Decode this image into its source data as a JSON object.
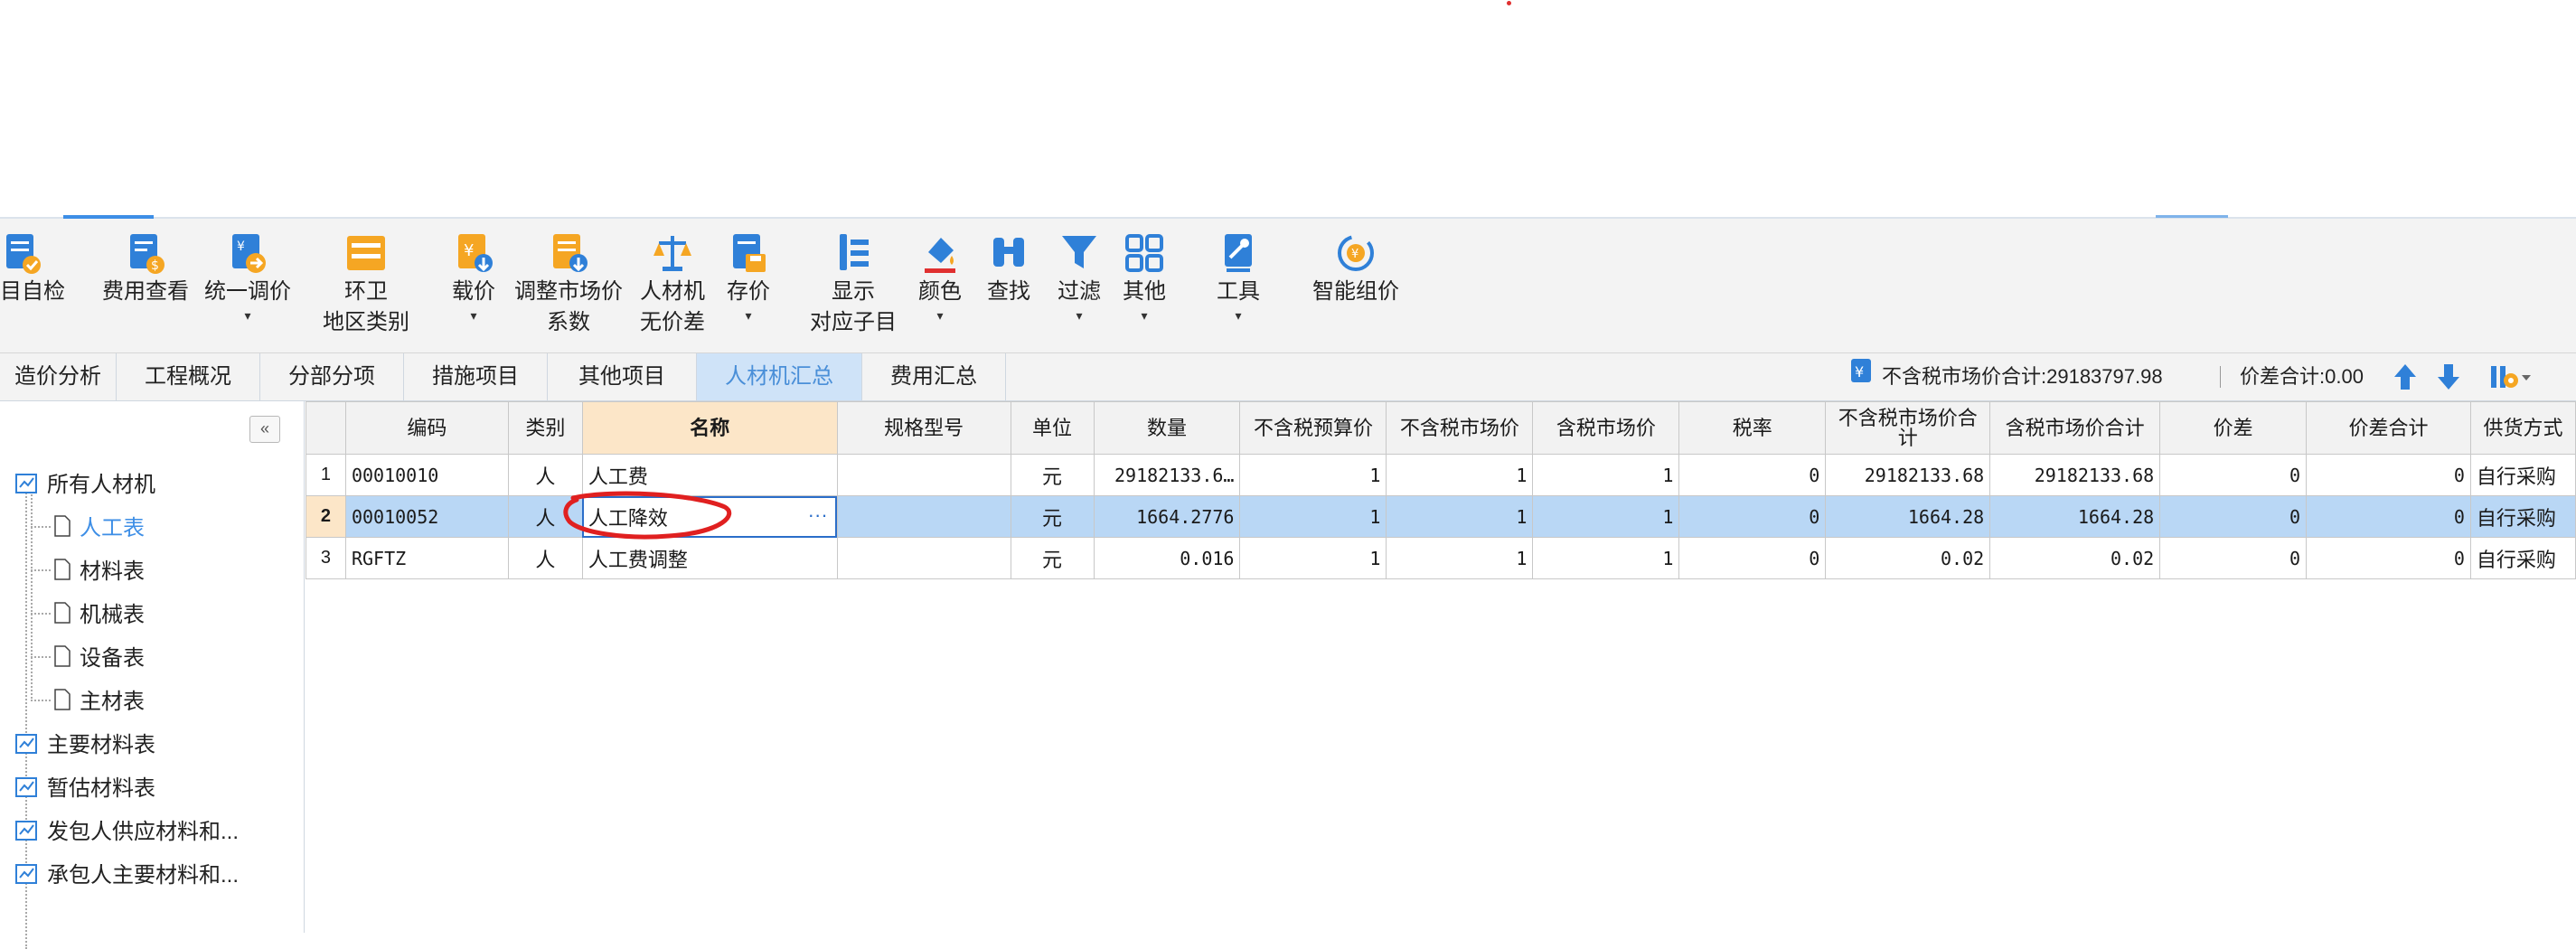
{
  "toolbar": {
    "items": [
      {
        "label": "项目自检",
        "icon": "project-check-icon"
      },
      {
        "label": "费用查看",
        "icon": "cost-view-icon"
      },
      {
        "label": "统一调价",
        "icon": "unified-price-adjust-icon"
      },
      {
        "label": "环卫\n地区类别",
        "icon": "region-category-icon"
      },
      {
        "label": "载价",
        "icon": "load-price-icon"
      },
      {
        "label": "调整市场价\n系数",
        "icon": "market-price-coefficient-icon"
      },
      {
        "label": "人材机\n无价差",
        "icon": "no-price-diff-icon"
      },
      {
        "label": "存价",
        "icon": "save-price-icon"
      },
      {
        "label": "显示\n对应子目",
        "icon": "show-subitem-icon"
      },
      {
        "label": "颜色",
        "icon": "color-icon"
      },
      {
        "label": "查找",
        "icon": "find-binoculars-icon"
      },
      {
        "label": "过滤",
        "icon": "filter-icon"
      },
      {
        "label": "其他",
        "icon": "other-grid-icon"
      },
      {
        "label": "工具",
        "icon": "tools-icon"
      },
      {
        "label": "智能组价",
        "icon": "smart-pricing-icon"
      }
    ]
  },
  "tabs": [
    "造价分析",
    "工程概况",
    "分部分项",
    "措施项目",
    "其他项目",
    "人材机汇总",
    "费用汇总"
  ],
  "active_tab": "人材机汇总",
  "summary": {
    "market_total": "不含税市场价合计:29183797.98",
    "price_diff_total": "价差合计:0.00"
  },
  "tree": {
    "root": "所有人材机",
    "children": [
      "人工表",
      "材料表",
      "机械表",
      "设备表",
      "主材表"
    ],
    "selected": "人工表",
    "others": [
      "主要材料表",
      "暂估材料表",
      "发包人供应材料和...",
      "承包人主要材料和..."
    ]
  },
  "table": {
    "headers": [
      "",
      "编码",
      "类别",
      "名称",
      "规格型号",
      "单位",
      "数量",
      "不含税预算价",
      "不含税市场价",
      "含税市场价",
      "税率",
      "不含税市场价合计",
      "含税市场价合计",
      "价差",
      "价差合计",
      "供货方式"
    ],
    "rows": [
      {
        "no": "1",
        "code": "00010010",
        "type": "人",
        "name": "人工费",
        "spec": "",
        "unit": "元",
        "qty": "29182133.6…",
        "budget": "1",
        "market": "1",
        "market_tax": "1",
        "rate": "0",
        "total": "29182133.68",
        "total_tax": "29182133.68",
        "diff": "0",
        "diff_total": "0",
        "supply": "自行采购"
      },
      {
        "no": "2",
        "code": "00010052",
        "type": "人",
        "name": "人工降效",
        "spec": "",
        "unit": "元",
        "qty": "1664.2776",
        "budget": "1",
        "market": "1",
        "market_tax": "1",
        "rate": "0",
        "total": "1664.28",
        "total_tax": "1664.28",
        "diff": "0",
        "diff_total": "0",
        "supply": "自行采购"
      },
      {
        "no": "3",
        "code": "RGFTZ",
        "type": "人",
        "name": "人工费调整",
        "spec": "",
        "unit": "元",
        "qty": "0.016",
        "budget": "1",
        "market": "1",
        "market_tax": "1",
        "rate": "0",
        "total": "0.02",
        "total_tax": "0.02",
        "diff": "0",
        "diff_total": "0",
        "supply": "自行采购"
      }
    ]
  },
  "colors": {
    "accent": "#3d8ee6",
    "selected_row": "#b9d7f5",
    "header_highlight": "#fce6c8",
    "annotation": "#e02020"
  }
}
